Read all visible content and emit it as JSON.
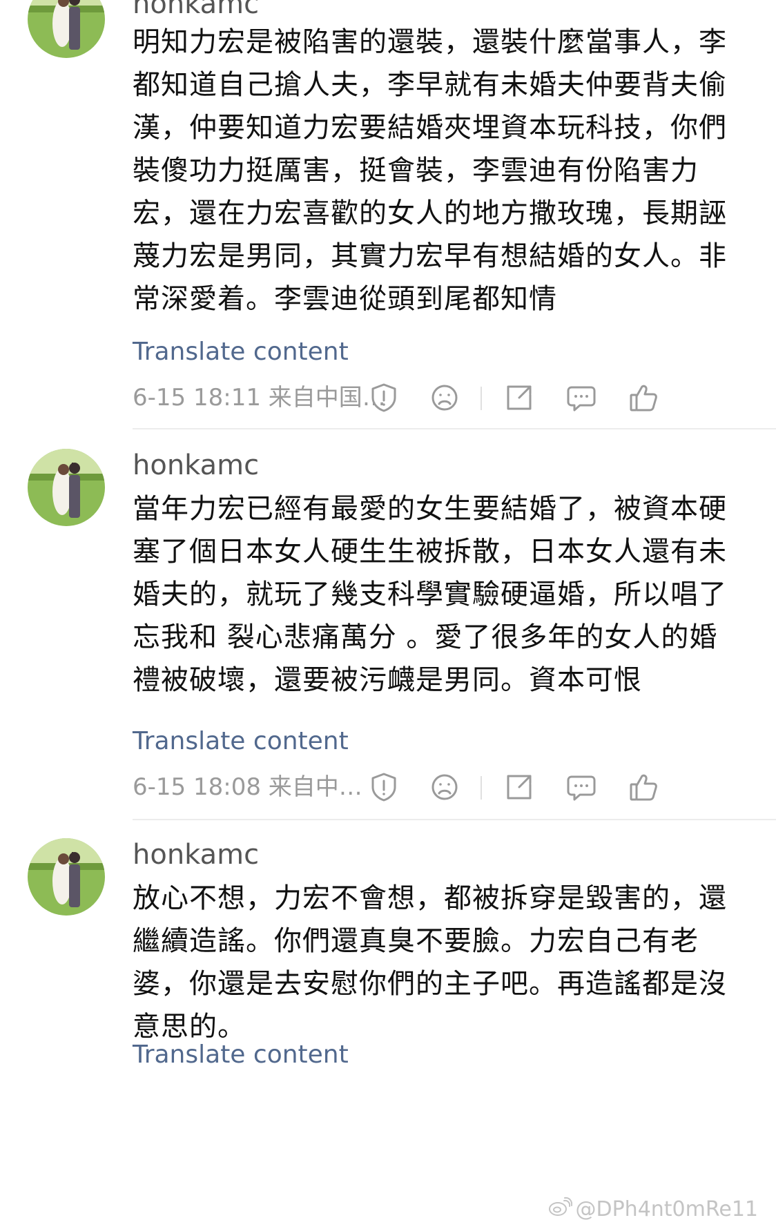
{
  "comments": [
    {
      "username": "honkamc",
      "text": "明知力宏是被陷害的還裝，還裝什麼當事人，李都知道自己搶人夫，李早就有未婚夫仲要背夫偷漢，仲要知道力宏要結婚夾埋資本玩科技，你們裝傻功力挺厲害，挺會裝，李雲迪有份陷害力宏，還在力宏喜歡的女人的地方撒玫瑰，長期誣蔑力宏是男同，其實力宏早有想結婚的女人。非常深愛着。李雲迪從頭到尾都知情",
      "translate_label": "Translate content",
      "meta": "6-15 18:11 来自中国…"
    },
    {
      "username": "honkamc",
      "text": "當年力宏已經有最愛的女生要結婚了，被資本硬塞了個日本女人硬生生被拆散，日本女人還有未婚夫的，就玩了幾支科學實驗硬逼婚，所以唱了忘我和 裂心悲痛萬分 。愛了很多年的女人的婚禮被破壞，還要被污衊是男同。資本可恨",
      "translate_label": "Translate content",
      "meta": "6-15 18:08 来自中…"
    },
    {
      "username": "honkamc",
      "text": "放心不想，力宏不會想，都被拆穿是毀害的，還繼續造謠。你們還真臭不要臉。力宏自己有老婆，你還是去安慰你們的主子吧。再造謠都是沒意思的。",
      "translate_label": "Translate content",
      "meta": ""
    }
  ],
  "action_icons": [
    "report-icon",
    "sad-face-icon",
    "share-icon",
    "reply-icon",
    "like-icon"
  ],
  "watermark": "@DPh4nt0mRe11",
  "colors": {
    "translate_link": "#51688d",
    "meta_text": "#9a9a9a",
    "icon_stroke": "#9a9a9a",
    "divider": "#ececec"
  }
}
